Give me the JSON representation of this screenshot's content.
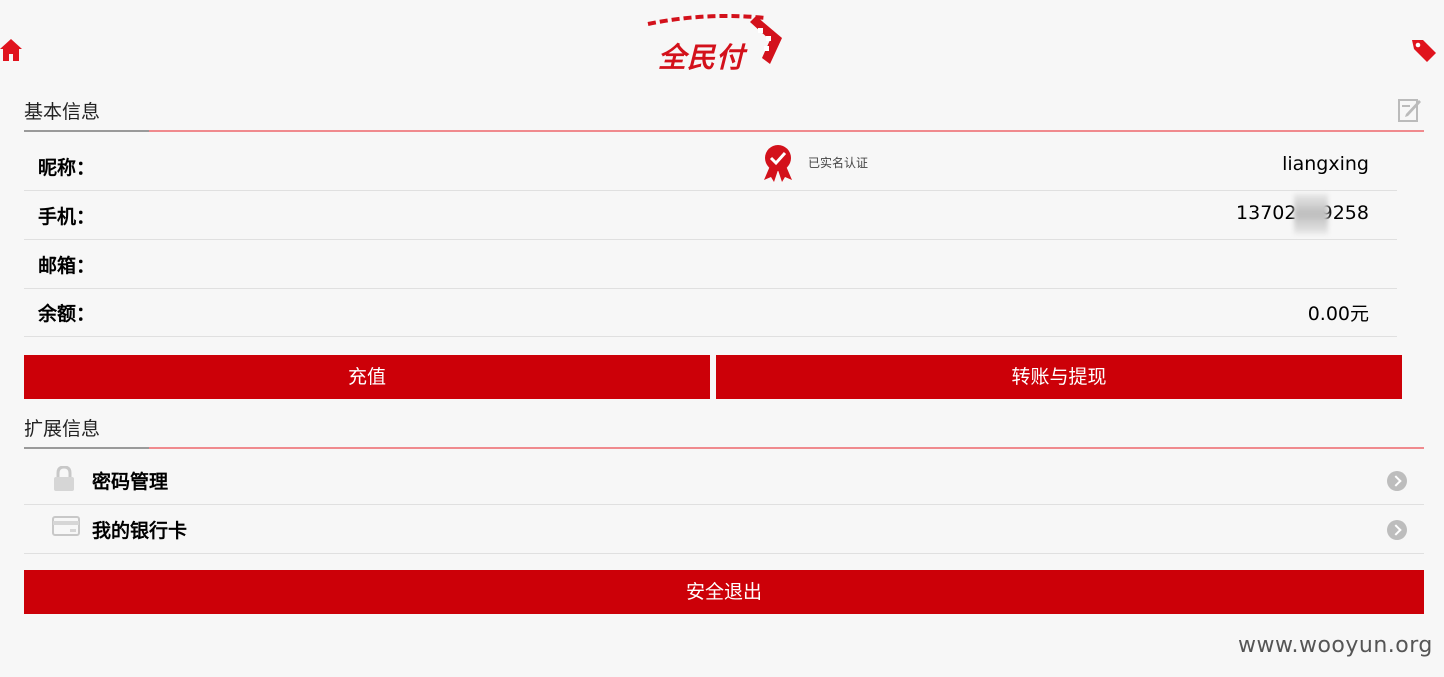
{
  "header": {
    "logo_text": "全民付",
    "home_icon": "home-icon",
    "tag_icon": "tag-icon"
  },
  "basic_info": {
    "title": "基本信息",
    "edit_icon": "edit-icon",
    "verified_badge": "已实名认证",
    "rows": [
      {
        "label": "昵称：",
        "value": "liangxing"
      },
      {
        "label": "手机：",
        "value": "13702    9258"
      },
      {
        "label": "邮箱：",
        "value": ""
      },
      {
        "label": "余额：",
        "value": "0.00元"
      }
    ]
  },
  "actions": {
    "recharge": "充值",
    "transfer": "转账与提现"
  },
  "extended_info": {
    "title": "扩展信息",
    "items": [
      {
        "label": "密码管理",
        "icon": "lock-icon"
      },
      {
        "label": "我的银行卡",
        "icon": "bank-card-icon"
      }
    ]
  },
  "logout": "安全退出",
  "watermark": "www.wooyun.org",
  "colors": {
    "accent": "#cc0008",
    "background": "#f7f7f7"
  }
}
